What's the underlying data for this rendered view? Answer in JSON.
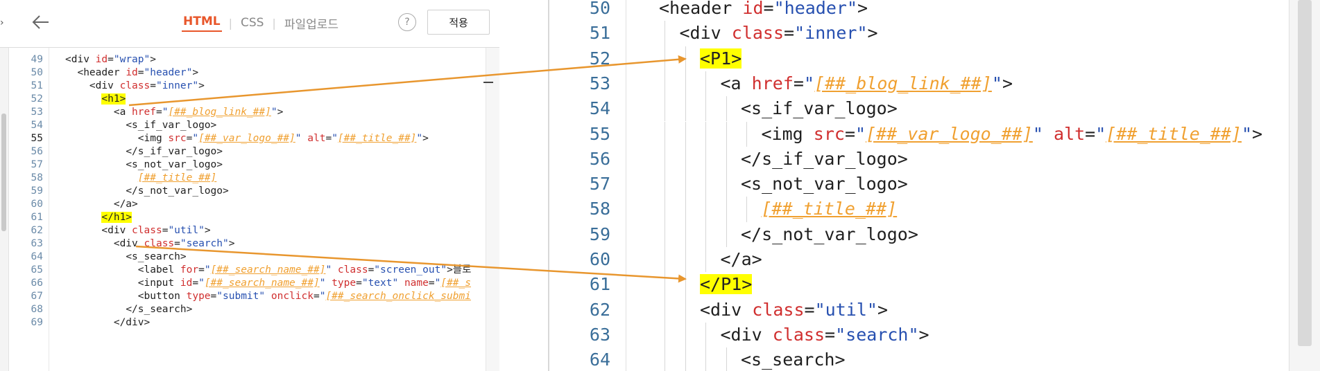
{
  "toolbar": {
    "tabs": [
      {
        "label": "HTML",
        "active": true
      },
      {
        "label": "CSS",
        "active": false
      },
      {
        "label": "파일업로드",
        "active": false
      }
    ],
    "help_label": "?",
    "apply_label": "적용",
    "back_icon": "arrow-left-icon"
  },
  "left_editor": {
    "lines": [
      {
        "n": "49",
        "c": "<div id=\"wrap\">"
      },
      {
        "n": "50",
        "c": "  <header id=\"header\">"
      },
      {
        "n": "51",
        "c": "    <div class=\"inner\">"
      },
      {
        "n": "52",
        "c": "      <h1>"
      },
      {
        "n": "53",
        "c": "        <a href=\"[##_blog_link_##]\">"
      },
      {
        "n": "54",
        "c": "          <s_if_var_logo>"
      },
      {
        "n": "55",
        "c": "            <img src=\"[##_var_logo_##]\" alt=\"[##_title_##]\">"
      },
      {
        "n": "56",
        "c": "          </s_if_var_logo>"
      },
      {
        "n": "57",
        "c": "          <s_not_var_logo>"
      },
      {
        "n": "58",
        "c": "            [##_title_##]"
      },
      {
        "n": "59",
        "c": "          </s_not_var_logo>"
      },
      {
        "n": "60",
        "c": "        </a>"
      },
      {
        "n": "61",
        "c": "      </h1>"
      },
      {
        "n": "62",
        "c": "      <div class=\"util\">"
      },
      {
        "n": "63",
        "c": "        <div class=\"search\">"
      },
      {
        "n": "64",
        "c": "          <s_search>"
      },
      {
        "n": "65",
        "c": "            <label for=\"[##_search_name_##]\" class=\"screen_out\">블로"
      },
      {
        "n": "66",
        "c": "            <input id=\"[##_search_name_##]\" type=\"text\" name=\"[##_s"
      },
      {
        "n": "67",
        "c": "            <button type=\"submit\" onclick=\"[##_search_onclick_submi"
      },
      {
        "n": "68",
        "c": "          </s_search>"
      },
      {
        "n": "69",
        "c": "        </div>"
      }
    ],
    "current_line": "55"
  },
  "right_editor": {
    "lines": [
      {
        "n": "50",
        "c": "<header id=\"header\">"
      },
      {
        "n": "51",
        "c": "<div class=\"inner\">"
      },
      {
        "n": "52",
        "c": "<P1>"
      },
      {
        "n": "53",
        "c": "<a href=\"[##_blog_link_##]\">"
      },
      {
        "n": "54",
        "c": "<s_if_var_logo>"
      },
      {
        "n": "55",
        "c": "<img src=\"[##_var_logo_##]\" alt=\"[##_title_##]\">"
      },
      {
        "n": "56",
        "c": "</s_if_var_logo>"
      },
      {
        "n": "57",
        "c": "<s_not_var_logo>"
      },
      {
        "n": "58",
        "c": "[##_title_##]"
      },
      {
        "n": "59",
        "c": "</s_not_var_logo>"
      },
      {
        "n": "60",
        "c": "</a>"
      },
      {
        "n": "61",
        "c": "</P1>"
      },
      {
        "n": "62",
        "c": "<div class=\"util\">"
      },
      {
        "n": "63",
        "c": "<div class=\"search\">"
      },
      {
        "n": "64",
        "c": "<s_search>"
      }
    ]
  },
  "colors": {
    "accent": "#e8562a",
    "highlight": "#ffff00",
    "arrow": "#e8962e",
    "attr": "#d02f2f",
    "string": "#2750b0",
    "template_var": "#f0a030",
    "line_number": "#3a6e99"
  }
}
